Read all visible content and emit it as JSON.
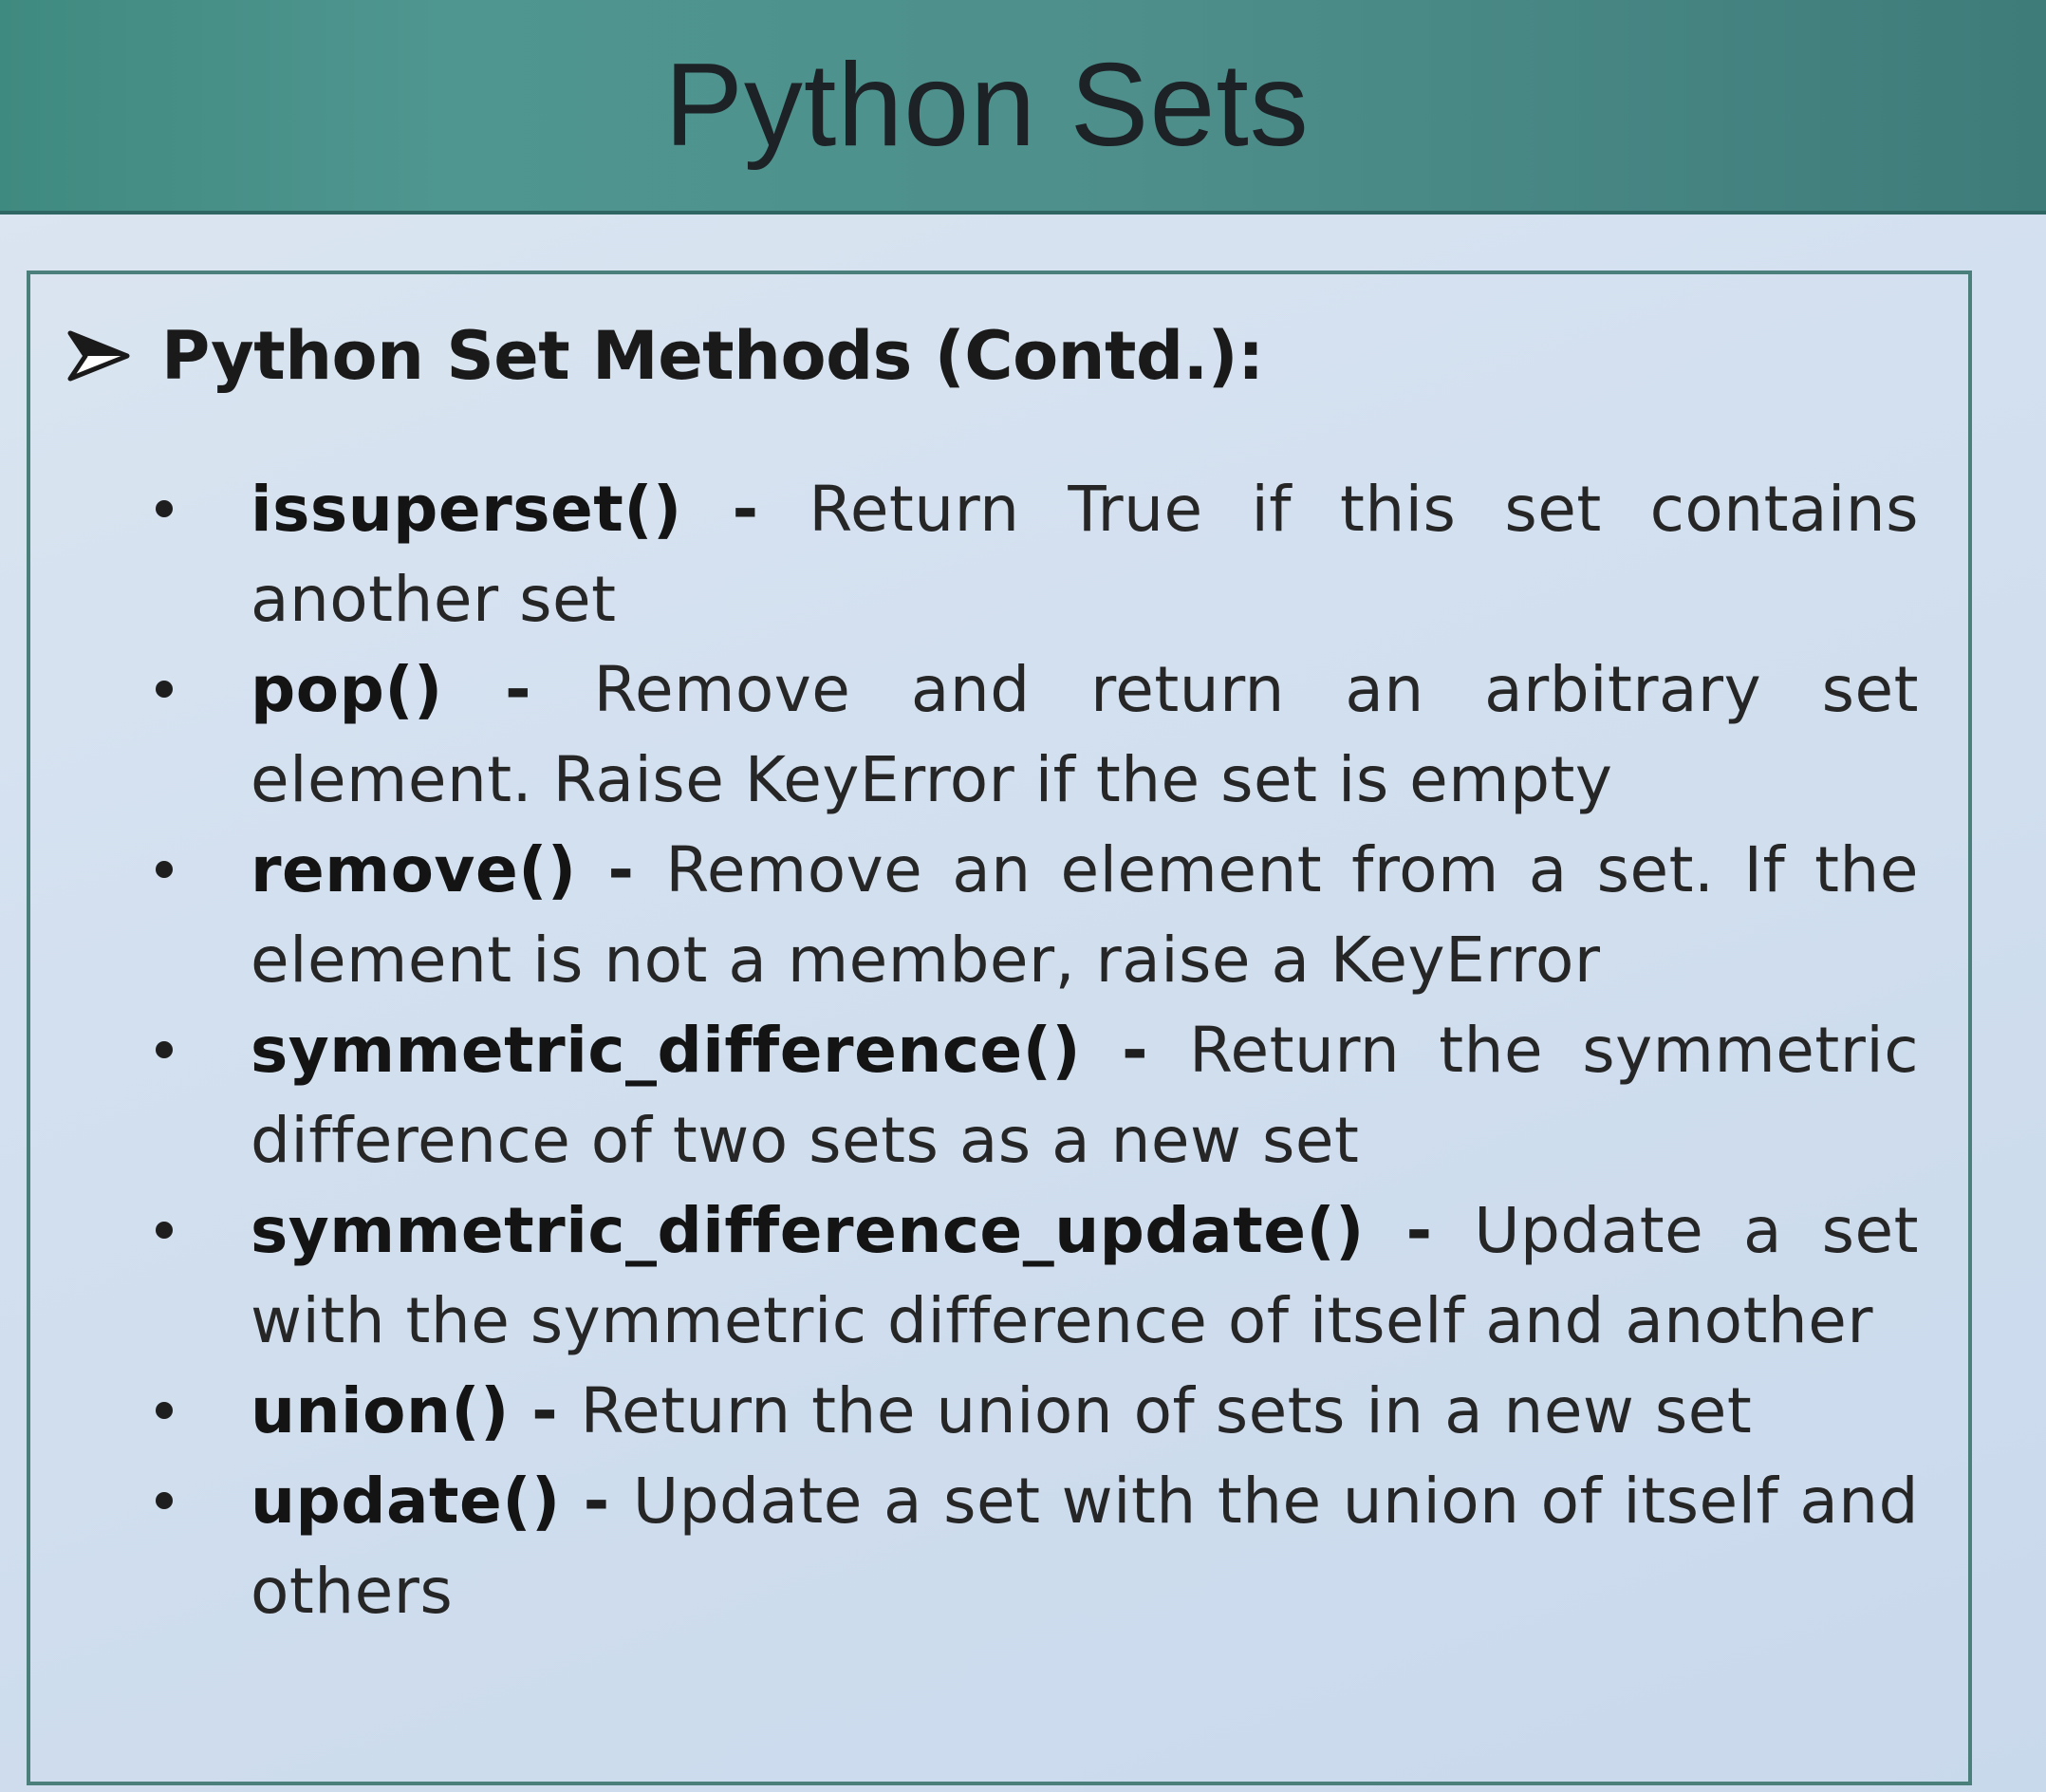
{
  "slide": {
    "title": "Python Sets",
    "heading": "Python Set Methods (Contd.):",
    "separator": " - ",
    "methods": [
      {
        "name": "issuperset()",
        "description": "Return True if this set contains another set"
      },
      {
        "name": "pop()",
        "description": "Remove and return an arbitrary set element. Raise KeyError if the set is empty"
      },
      {
        "name": "remove()",
        "description": "Remove an element from a set. If the element is not a member, raise a KeyError"
      },
      {
        "name": "symmetric_difference()",
        "description": "Return the symmetric difference of two sets as a new set"
      },
      {
        "name": "symmetric_difference_update()",
        "description": "Update a set with the symmetric difference of itself and another"
      },
      {
        "name": "union()",
        "description": "Return the union of sets in a new set"
      },
      {
        "name": "update()",
        "description": "Update a set with the union of itself and others"
      }
    ]
  },
  "colors": {
    "title_bar": "#4f9690",
    "slide_background": "#d3e0ef",
    "box_border": "#4a7f7c",
    "text": "#1e1e1e"
  },
  "icons": {
    "heading_marker": "arrow-bullet-icon",
    "list_marker": "round-bullet-icon"
  }
}
